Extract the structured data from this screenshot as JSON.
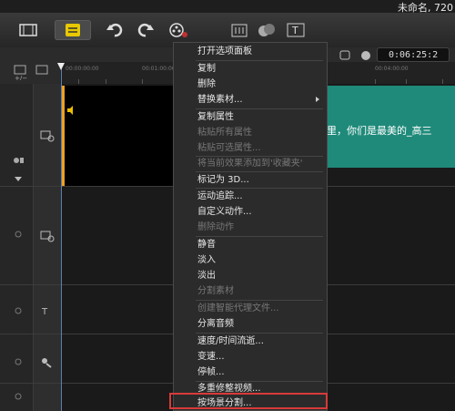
{
  "window": {
    "title": "未命名, 720"
  },
  "timeline": {
    "timecode": "0:06:25:2",
    "ruler_ticks": [
      "00:00:00:00",
      "00:01:00:00",
      "00:04:00:00"
    ]
  },
  "clips": {
    "title_text": "时光里，你们是最美的_高三"
  },
  "context_menu": {
    "items": [
      {
        "label": "打开选项面板",
        "disabled": false
      },
      {
        "label": "复制",
        "disabled": false
      },
      {
        "label": "删除",
        "disabled": false
      },
      {
        "label": "替换素材...",
        "disabled": false,
        "submenu": true
      },
      {
        "label": "复制属性",
        "disabled": false
      },
      {
        "label": "粘贴所有属性",
        "disabled": true
      },
      {
        "label": "粘贴可选属性...",
        "disabled": true
      },
      {
        "label": "将当前效果添加到'收藏夹'",
        "disabled": true
      },
      {
        "label": "标记为 3D...",
        "disabled": false
      },
      {
        "label": "运动追踪...",
        "disabled": false
      },
      {
        "label": "自定义动作...",
        "disabled": false
      },
      {
        "label": "删除动作",
        "disabled": true
      },
      {
        "label": "静音",
        "disabled": false
      },
      {
        "label": "淡入",
        "disabled": false
      },
      {
        "label": "淡出",
        "disabled": false
      },
      {
        "label": "分割素材",
        "disabled": true
      },
      {
        "label": "创建智能代理文件...",
        "disabled": true
      },
      {
        "label": "分离音频",
        "disabled": false
      },
      {
        "label": "速度/时间流逝...",
        "disabled": false
      },
      {
        "label": "变速...",
        "disabled": false
      },
      {
        "label": "停帧...",
        "disabled": false
      },
      {
        "label": "多重修整视频...",
        "disabled": false
      },
      {
        "label": "按场景分割...",
        "disabled": false,
        "highlighted": true
      }
    ]
  },
  "colors": {
    "accent": "#f0a020",
    "title_clip": "#1f8a7a",
    "highlight_box": "#d83a3a"
  }
}
